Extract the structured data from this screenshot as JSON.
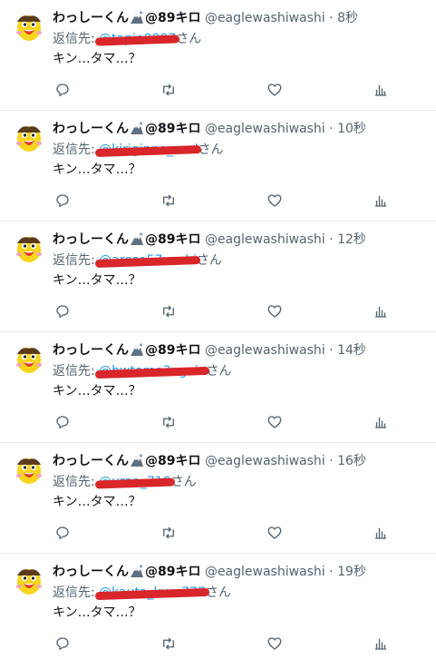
{
  "tweets": [
    {
      "name": "わっしーくん",
      "suffix": "@89キロ",
      "handle": "@eaglewashiwashi",
      "dot": "·",
      "time": "8秒",
      "reply_prefix": "返信先:",
      "mention_redacted": "@tapio0007",
      "mention_suffix": "さん",
      "text": "キン…タマ…？"
    },
    {
      "name": "わっしーくん",
      "suffix": "@89キロ",
      "handle": "@eaglewashiwashi",
      "dot": "·",
      "time": "10秒",
      "reply_prefix": "返信先:",
      "mention_redacted": "@kiriginno_swd",
      "mention_suffix": "さん",
      "text": "キン…タマ…？"
    },
    {
      "name": "わっしーくん",
      "suffix": "@89キロ",
      "handle": "@eaglewashiwashi",
      "dot": "·",
      "time": "12秒",
      "reply_prefix": "返信先:",
      "mention_redacted": "@areso57vechi",
      "mention_suffix": "さん",
      "text": "キン…タマ…？"
    },
    {
      "name": "わっしーくん",
      "suffix": "@89キロ",
      "handle": "@eaglewashiwashi",
      "dot": "·",
      "time": "14秒",
      "reply_prefix": "返信先:",
      "mention_redacted": "@bwtomo3again",
      "mention_suffix": "さん",
      "text": "キン…タマ…？"
    },
    {
      "name": "わっしーくん",
      "suffix": "@89キロ",
      "handle": "@eaglewashiwashi",
      "dot": "·",
      "time": "16秒",
      "reply_prefix": "返信先:",
      "mention_redacted": "@uraa_710",
      "mention_suffix": "さん",
      "text": "キン…タマ…？"
    },
    {
      "name": "わっしーくん",
      "suffix": "@89キロ",
      "handle": "@eaglewashiwashi",
      "dot": "·",
      "time": "19秒",
      "reply_prefix": "返信先:",
      "mention_redacted": "@kauta_kuro777",
      "mention_suffix": "さん",
      "text": "キン…タマ…？"
    }
  ],
  "actions": [
    "reply-icon",
    "retweet-icon",
    "like-icon",
    "analytics-icon"
  ],
  "colors": {
    "mention": "#1d9bf0",
    "redaction": "#d8262b",
    "muted": "#536471"
  }
}
